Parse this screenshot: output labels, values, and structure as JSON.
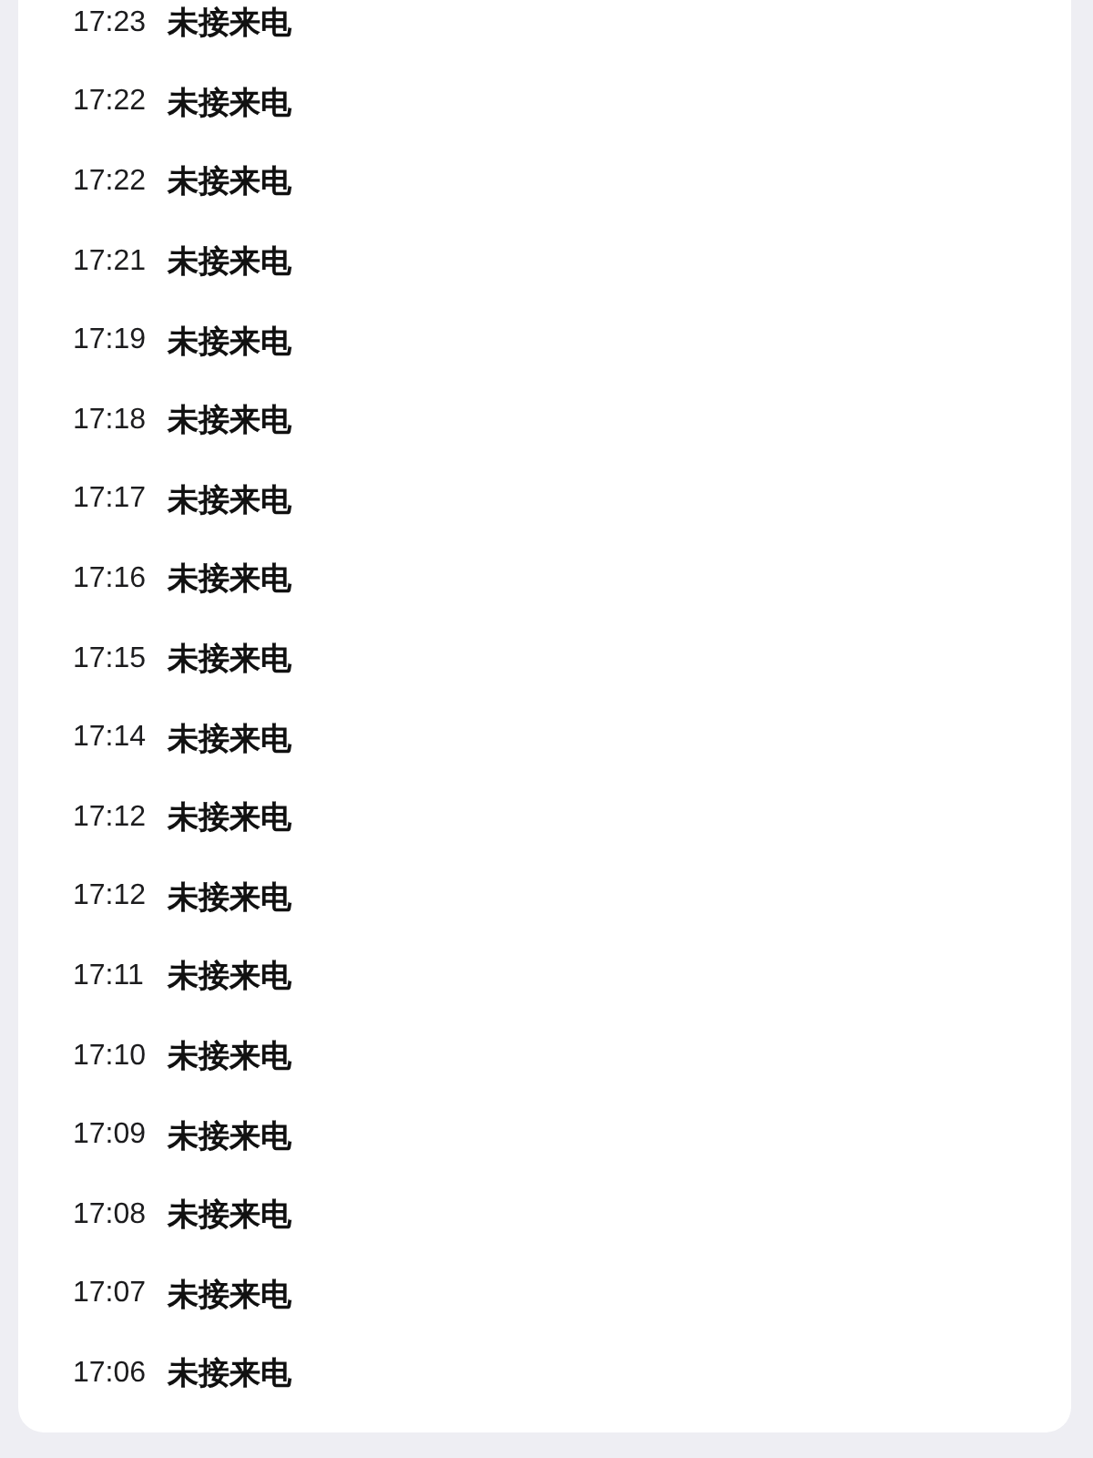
{
  "calls": [
    {
      "time": "17:23",
      "status": "未接来电"
    },
    {
      "time": "17:22",
      "status": "未接来电"
    },
    {
      "time": "17:22",
      "status": "未接来电"
    },
    {
      "time": "17:21",
      "status": "未接来电"
    },
    {
      "time": "17:19",
      "status": "未接来电"
    },
    {
      "time": "17:18",
      "status": "未接来电"
    },
    {
      "time": "17:17",
      "status": "未接来电"
    },
    {
      "time": "17:16",
      "status": "未接来电"
    },
    {
      "time": "17:15",
      "status": "未接来电"
    },
    {
      "time": "17:14",
      "status": "未接来电"
    },
    {
      "time": "17:12",
      "status": "未接来电"
    },
    {
      "time": "17:12",
      "status": "未接来电"
    },
    {
      "time": "17:11",
      "status": "未接来电"
    },
    {
      "time": "17:10",
      "status": "未接来电"
    },
    {
      "time": "17:09",
      "status": "未接来电"
    },
    {
      "time": "17:08",
      "status": "未接来电"
    },
    {
      "time": "17:07",
      "status": "未接来电"
    },
    {
      "time": "17:06",
      "status": "未接来电"
    }
  ]
}
